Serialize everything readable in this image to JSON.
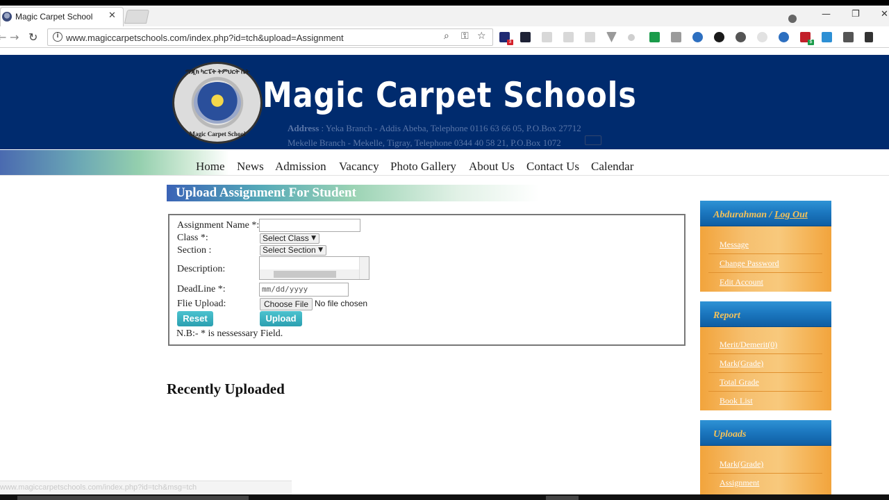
{
  "browser": {
    "tab_title": "Magic Carpet School",
    "tab_close": "✕",
    "url": "www.magiccarpetschools.com/index.php?id=tch&upload=Assignment",
    "status_url": "www.magiccarpetschools.com/index.php?id=tch&msg=tch",
    "window_controls": [
      "minimize-icon",
      "restore-icon",
      "close-icon"
    ]
  },
  "site": {
    "title": "Magic Carpet Schools",
    "logo_ring_top": "ማጂክ ካርፔት ትምህርት ቤት",
    "logo_ring_bottom": "Magic Carpet School",
    "address_label": "Address",
    "address_line1": " : Yeka Branch - Addis Abeba, Telephone 0116 63 66 05, P.O.Box 27712",
    "address_line2": "Mekelle Branch - Mekelle, Tigray, Telephone 0344 40 58 21, P.O.Box 1072"
  },
  "menu": {
    "items": [
      "Home",
      "News",
      "Admission",
      "Vacancy",
      "Photo Gallery",
      "About Us",
      "Contact Us",
      "Calendar"
    ]
  },
  "upload": {
    "heading": "Upload Assignment For Student",
    "assignment_name_label": "Assignment Name *:",
    "assignment_name_value": "",
    "class_label": "Class *:",
    "class_selected": "Select Class",
    "section_label": "Section :",
    "section_selected": "Select Section",
    "description_label": "Description:",
    "deadline_label": "DeadLine *:",
    "deadline_placeholder": "mm/dd/yyyy",
    "file_label": "Flie Upload:",
    "choose_file_label": "Choose File",
    "file_status": "No file chosen",
    "reset_label": "Reset",
    "upload_label": "Upload",
    "note": "N.B:- * is nessessary Field."
  },
  "recent": {
    "heading": "Recently Uploaded"
  },
  "sidebar": {
    "user_name": "Abdurahman / ",
    "logout_label": "Log Out",
    "account_links": [
      "Message",
      "Change Password",
      "Edit Account"
    ],
    "report_title": "Report",
    "report_links": [
      "Merit/Demerit(0)",
      "Mark(Grade)",
      "Total Grade",
      "Book List"
    ],
    "uploads_title": "Uploads",
    "uploads_links": [
      "Mark(Grade)",
      "Assignment"
    ]
  },
  "colors": {
    "header_bg": "#002b6e",
    "accent_teal": "#2b9fb0",
    "sidebar_orange": "#f2a43c",
    "sidebar_blue": "#1c78c0"
  }
}
